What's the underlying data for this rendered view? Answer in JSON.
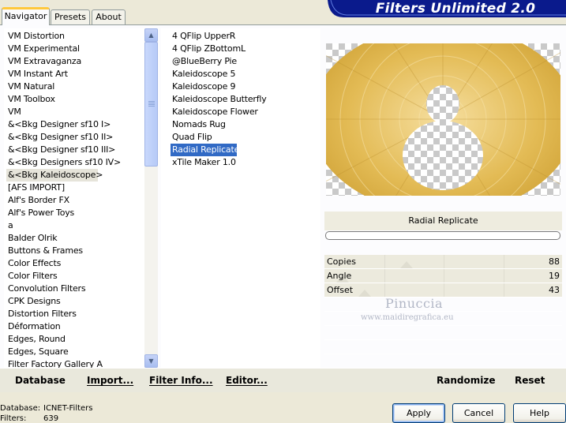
{
  "app": {
    "title": "Filters Unlimited 2.0"
  },
  "tabs": [
    {
      "label": "Navigator",
      "active": true
    },
    {
      "label": "Presets",
      "active": false
    },
    {
      "label": "About",
      "active": false
    }
  ],
  "categories": {
    "items": [
      "VM Distortion",
      "VM Experimental",
      "VM Extravaganza",
      "VM Instant Art",
      "VM Natural",
      "VM Toolbox",
      "VM",
      "&<Bkg Designer sf10 I>",
      "&<Bkg Designer sf10 II>",
      "&<Bkg Designer sf10 III>",
      "&<Bkg Designers sf10 IV>",
      "&<Bkg Kaleidoscope>",
      "[AFS IMPORT]",
      "Alf's Border FX",
      "Alf's Power Toys",
      "a",
      "Balder Olrik",
      "Buttons & Frames",
      "Color Effects",
      "Color Filters",
      "Convolution Filters",
      "CPK Designs",
      "Distortion Filters",
      "Déformation",
      "Edges, Round",
      "Edges, Square",
      "Filter Factory Gallery A"
    ],
    "selected": "&<Bkg Kaleidoscope>"
  },
  "filters": {
    "items": [
      "4 QFlip UpperR",
      "4 QFlip ZBottomL",
      "@BlueBerry Pie",
      "Kaleidoscope 5",
      "Kaleidoscope 9",
      "Kaleidoscope Butterfly",
      "Kaleidoscope Flower",
      "Nomads Rug",
      "Quad Flip",
      "Radial Replicate",
      "xTile Maker 1.0"
    ],
    "selected": "Radial Replicate"
  },
  "current_filter": "Radial Replicate",
  "params": [
    {
      "label": "Copies",
      "value": "88",
      "level": 0.345
    },
    {
      "label": "Angle",
      "value": "19",
      "level": 0.075
    },
    {
      "label": "Offset",
      "value": "43",
      "level": 0.169
    }
  ],
  "watermark": {
    "name": "Pinuccia",
    "site": "www.maidiregrafica.eu"
  },
  "actions": {
    "database": "Database",
    "import": "Import...",
    "filter_info": "Filter Info...",
    "editor": "Editor...",
    "randomize": "Randomize",
    "reset": "Reset"
  },
  "status": {
    "database_label": "Database:",
    "database_value": "ICNET-Filters",
    "filters_label": "Filters:",
    "filters_value": "639"
  },
  "buttons": {
    "apply": "Apply",
    "cancel": "Cancel",
    "help": "Help"
  },
  "colors": {
    "selection": "#316ac5",
    "banner": "#0a1a8c",
    "tab_highlight": "#ffc83c",
    "preview_gold": "#d9ae3a"
  }
}
